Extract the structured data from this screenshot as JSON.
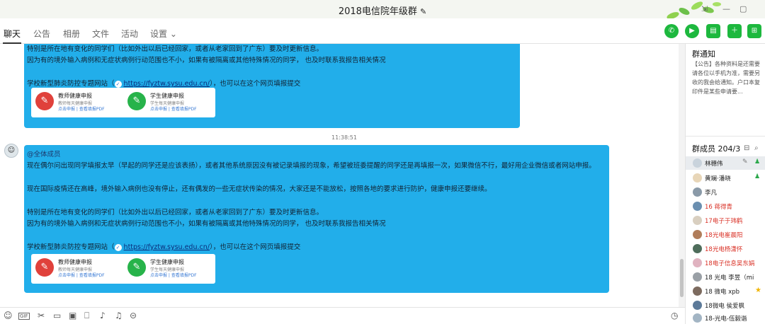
{
  "window": {
    "title": "2018电信院年级群",
    "edit_icon": "pencil-icon",
    "controls": [
      "skin-icon",
      "minimize-icon",
      "maximize-icon"
    ]
  },
  "tabs": [
    {
      "label": "聊天",
      "active": true
    },
    {
      "label": "公告"
    },
    {
      "label": "相册"
    },
    {
      "label": "文件"
    },
    {
      "label": "活动"
    },
    {
      "label": "设置"
    }
  ],
  "toolbar_icons": [
    "phone-icon",
    "video-icon",
    "screen-share-icon",
    "add-app-icon",
    "more-icon"
  ],
  "messages": [
    {
      "lines": [
        "特别是所在地有变化的同学们（比如外出以后已经回家，或者从老家回到了广东）要及时更新信息。",
        "因为有的境外输入病例和无症状病例行动范围也不小，如果有被隔离或其他特殊情况的同学， 也及时联系我报告相关情况"
      ],
      "link_prefix": "学校新型肺炎防控专题网站（",
      "link_url": "https://fyztw.sysu.edu.cn/",
      "link_suffix": "），也可以在这个网页填报提交",
      "cards": [
        {
          "title": "教师健康申报",
          "sub": "教师每天健康申报",
          "links": "点击申报  |  查看填报PDF"
        },
        {
          "title": "学生健康申报",
          "sub": "学生每天健康申报",
          "links": "点击申报  |  查看填报PDF"
        }
      ]
    },
    {
      "timestamp": "11:38:51",
      "mention": "@全体成员",
      "lines": [
        "现在偶尔问出现同学填报太早（早起的同学还是应该表扬），或者其他系统原因没有被记录填报的现象，希望被班委提醒的同学还是再填报一次，如果微信不行，最好用企业微信或者网站申报。",
        "",
        "现在国际疫情还在高峰，境外输入病例也没有停止，还有偶发的一些无症状传染的情况，大家还是不能放松，按照各地的要求进行防护，健康申报还要继续。",
        "",
        "特别是所在地有变化的同学们（比如外出以后已经回家，或者从老家回到了广东）要及时更新信息。",
        "因为有的境外输入病例和无症状病例行动范围也不小，如果有被隔离或其他特殊情况的同学， 也及时联系我报告相关情况"
      ],
      "link_prefix": "学校新型肺炎防控专题网站（",
      "link_url": "https://fyztw.sysu.edu.cn/",
      "link_suffix": "），也可以在这个网页填报提交",
      "cards": [
        {
          "title": "教师健康申报",
          "sub": "教师每天健康申报",
          "links": "点击申报  |  查看填报PDF"
        },
        {
          "title": "学生健康申报",
          "sub": "学生每天健康申报",
          "links": "点击申报  |  查看填报PDF"
        }
      ]
    }
  ],
  "input_toolbar_icons": [
    "emoji-icon",
    "gif-icon",
    "scissors-icon",
    "folder-icon",
    "image-icon",
    "gift-icon",
    "voice-icon",
    "bell-icon",
    "more-circle-icon",
    "history-icon"
  ],
  "gif_label": "GIF",
  "right_panel": {
    "notice_title": "群通知",
    "notice_text": "【公告】各种资料是还需要请各位以手机为准，需要另收的我会给通知。户口本复印件是某些申请要...",
    "members_title": "群成员 204/3",
    "members": [
      {
        "name": "林穗伟",
        "color": "#222222",
        "avatar": "#c9d3dc",
        "selected": true,
        "badge": "person-icon"
      },
      {
        "name": "黄斓·潘晓",
        "color": "#222222",
        "avatar": "#e8d6b8",
        "badge": "person-icon"
      },
      {
        "name": "李凡",
        "color": "#222222",
        "avatar": "#8a9aa8",
        "badge": ""
      },
      {
        "name": "16 蒋得青",
        "color": "#d93025",
        "avatar": "#6b8fb0",
        "badge": ""
      },
      {
        "name": "17电子于玮鹤",
        "color": "#d93025",
        "avatar": "#d9cfc0",
        "badge": ""
      },
      {
        "name": "18光电崔晨阳",
        "color": "#d93025",
        "avatar": "#b07d5a",
        "badge": ""
      },
      {
        "name": "18光电杨潇怀",
        "color": "#d93025",
        "avatar": "#4e6d5b",
        "badge": ""
      },
      {
        "name": "18电子信息吴东娟",
        "color": "#d93025",
        "avatar": "#e0b3c0",
        "badge": ""
      },
      {
        "name": "18 光电 李昱（mi",
        "color": "#222222",
        "avatar": "#9aa0a6",
        "badge": ""
      },
      {
        "name": "18 微电 xpb",
        "color": "#222222",
        "avatar": "#7d6b5f",
        "badge": "star-icon"
      },
      {
        "name": "18微电 侯爱枫",
        "color": "#222222",
        "avatar": "#5c7a99",
        "badge": ""
      },
      {
        "name": "18-光电-伍毅谐",
        "color": "#222222",
        "avatar": "#a3b5c4",
        "badge": ""
      }
    ]
  }
}
